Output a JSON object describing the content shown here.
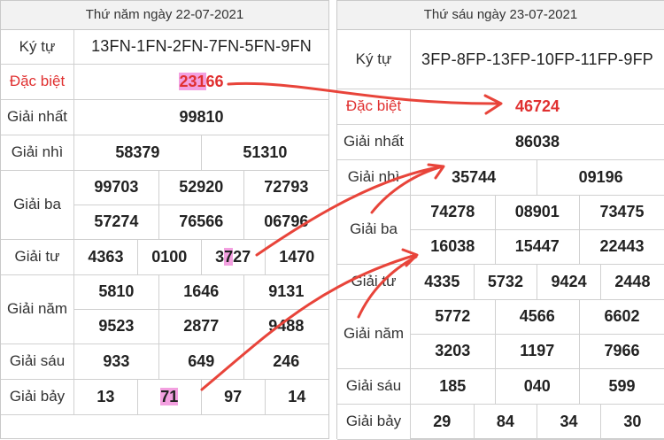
{
  "left": {
    "title": "Thứ năm ngày 22-07-2021",
    "ky_tu": {
      "label": "Ký tự",
      "value": "13FN-1FN-2FN-7FN-5FN-9FN"
    },
    "dac_biet": {
      "label": "Đặc biệt",
      "value": "23166"
    },
    "nhat": {
      "label": "Giải nhất",
      "value": "99810"
    },
    "nhi": {
      "label": "Giải nhì",
      "values": [
        "58379",
        "51310"
      ]
    },
    "ba": {
      "label": "Giải ba",
      "values": [
        "99703",
        "52920",
        "72793",
        "57274",
        "76566",
        "06796"
      ]
    },
    "tu": {
      "label": "Giải tư",
      "values": [
        "4363",
        "0100",
        "3727",
        "1470"
      ]
    },
    "nam": {
      "label": "Giải năm",
      "values": [
        "5810",
        "1646",
        "9131",
        "9523",
        "2877",
        "9488"
      ]
    },
    "sau": {
      "label": "Giải sáu",
      "values": [
        "933",
        "649",
        "246"
      ]
    },
    "bay": {
      "label": "Giải bảy",
      "values": [
        "13",
        "71",
        "97",
        "14"
      ]
    }
  },
  "right": {
    "title": "Thứ sáu ngày 23-07-2021",
    "ky_tu": {
      "label": "Ký tự",
      "value": "3FP-8FP-13FP-10FP-11FP-9FP"
    },
    "dac_biet": {
      "label": "Đặc biệt",
      "value": "46724"
    },
    "nhat": {
      "label": "Giải nhất",
      "value": "86038"
    },
    "nhi": {
      "label": "Giải nhì",
      "values": [
        "35744",
        "09196"
      ]
    },
    "ba": {
      "label": "Giải ba",
      "values": [
        "74278",
        "08901",
        "73475",
        "16038",
        "15447",
        "22443"
      ]
    },
    "tu": {
      "label": "Giải tư",
      "values": [
        "4335",
        "5732",
        "9424",
        "2448"
      ]
    },
    "nam": {
      "label": "Giải năm",
      "values": [
        "5772",
        "4566",
        "6602",
        "3203",
        "1197",
        "7966"
      ]
    },
    "sau": {
      "label": "Giải sáu",
      "values": [
        "185",
        "040",
        "599"
      ]
    },
    "bay": {
      "label": "Giải bảy",
      "values": [
        "29",
        "84",
        "34",
        "30"
      ]
    }
  },
  "colors": {
    "special": "#e03030",
    "highlight": "#f3a0e0",
    "annotation": "#e8443a"
  }
}
